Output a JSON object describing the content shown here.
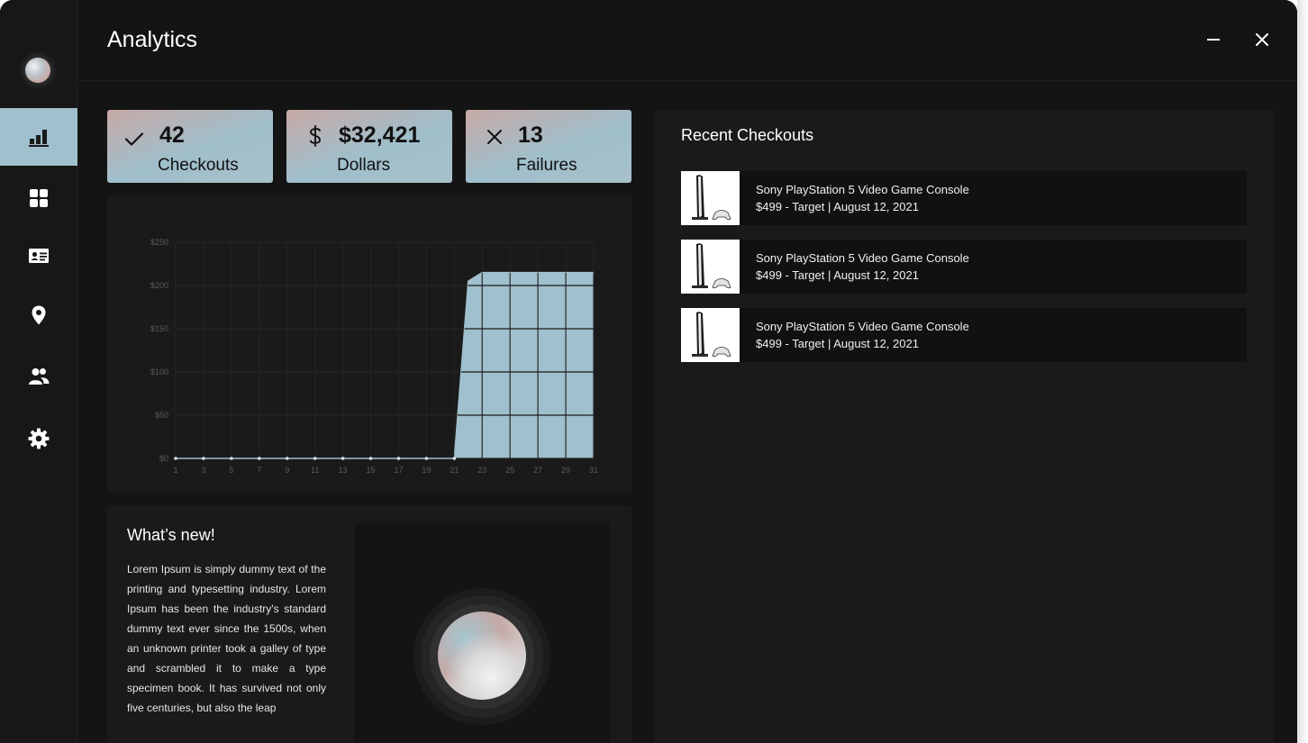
{
  "header": {
    "title": "Analytics"
  },
  "sidebar": {
    "items": [
      {
        "icon": "bar-chart-icon",
        "active": true
      },
      {
        "icon": "grid-icon",
        "active": false
      },
      {
        "icon": "id-card-icon",
        "active": false
      },
      {
        "icon": "location-pin-icon",
        "active": false
      },
      {
        "icon": "users-icon",
        "active": false
      },
      {
        "icon": "gear-icon",
        "active": false
      }
    ]
  },
  "stats": [
    {
      "value": "42",
      "label": "Checkouts",
      "icon": "check-icon"
    },
    {
      "value": "$32,421",
      "label": "Dollars",
      "icon": "dollar-icon"
    },
    {
      "value": "13",
      "label": "Failures",
      "icon": "x-icon"
    }
  ],
  "colors": {
    "accent": "#9fc0cc",
    "background": "#141414",
    "panel": "#1a1a1a",
    "card_gradient_start": "#c7a9a6",
    "card_gradient_end": "#9fbfcb"
  },
  "chart_data": {
    "type": "area",
    "x": [
      1,
      2,
      3,
      4,
      5,
      6,
      7,
      8,
      9,
      10,
      11,
      12,
      13,
      14,
      15,
      16,
      17,
      18,
      19,
      20,
      21,
      22,
      23,
      24,
      25,
      26,
      27,
      28,
      29,
      30,
      31
    ],
    "values": [
      0,
      0,
      0,
      0,
      0,
      0,
      0,
      0,
      0,
      0,
      0,
      0,
      0,
      0,
      0,
      0,
      0,
      0,
      0,
      0,
      0,
      205,
      215,
      215,
      215,
      215,
      215,
      215,
      215,
      215,
      215
    ],
    "marker_indices": [
      0,
      2,
      4,
      6,
      8,
      10,
      12,
      14,
      16,
      18,
      20
    ],
    "x_ticks": [
      "1",
      "3",
      "5",
      "7",
      "9",
      "11",
      "13",
      "15",
      "17",
      "19",
      "21",
      "23",
      "25",
      "27",
      "29",
      "31"
    ],
    "y_ticks": [
      {
        "value": 0,
        "label": "$0"
      },
      {
        "value": 50,
        "label": "$50"
      },
      {
        "value": 100,
        "label": "$100"
      },
      {
        "value": 150,
        "label": "$150"
      },
      {
        "value": 200,
        "label": "$200"
      },
      {
        "value": 250,
        "label": "$250"
      }
    ],
    "ylim": [
      0,
      250
    ],
    "xlim": [
      1,
      31
    ],
    "grid": true,
    "fill_color": "#9fc0cc"
  },
  "news": {
    "title": "What’s new!",
    "body": "Lorem Ipsum is simply dummy text of the printing and typesetting industry. Lorem Ipsum has been the industry's standard dummy text ever since the 1500s, when an unknown printer took a galley of type and scrambled it to make a type specimen book. It has survived not only five centuries, but also the leap"
  },
  "recent": {
    "title": "Recent Checkouts",
    "items": [
      {
        "name": "Sony PlayStation 5 Video Game Console",
        "meta": "$499 - Target | August 12, 2021"
      },
      {
        "name": "Sony PlayStation 5 Video Game Console",
        "meta": "$499 - Target | August 12, 2021"
      },
      {
        "name": "Sony PlayStation 5 Video Game Console",
        "meta": "$499 - Target | August 12, 2021"
      }
    ]
  }
}
